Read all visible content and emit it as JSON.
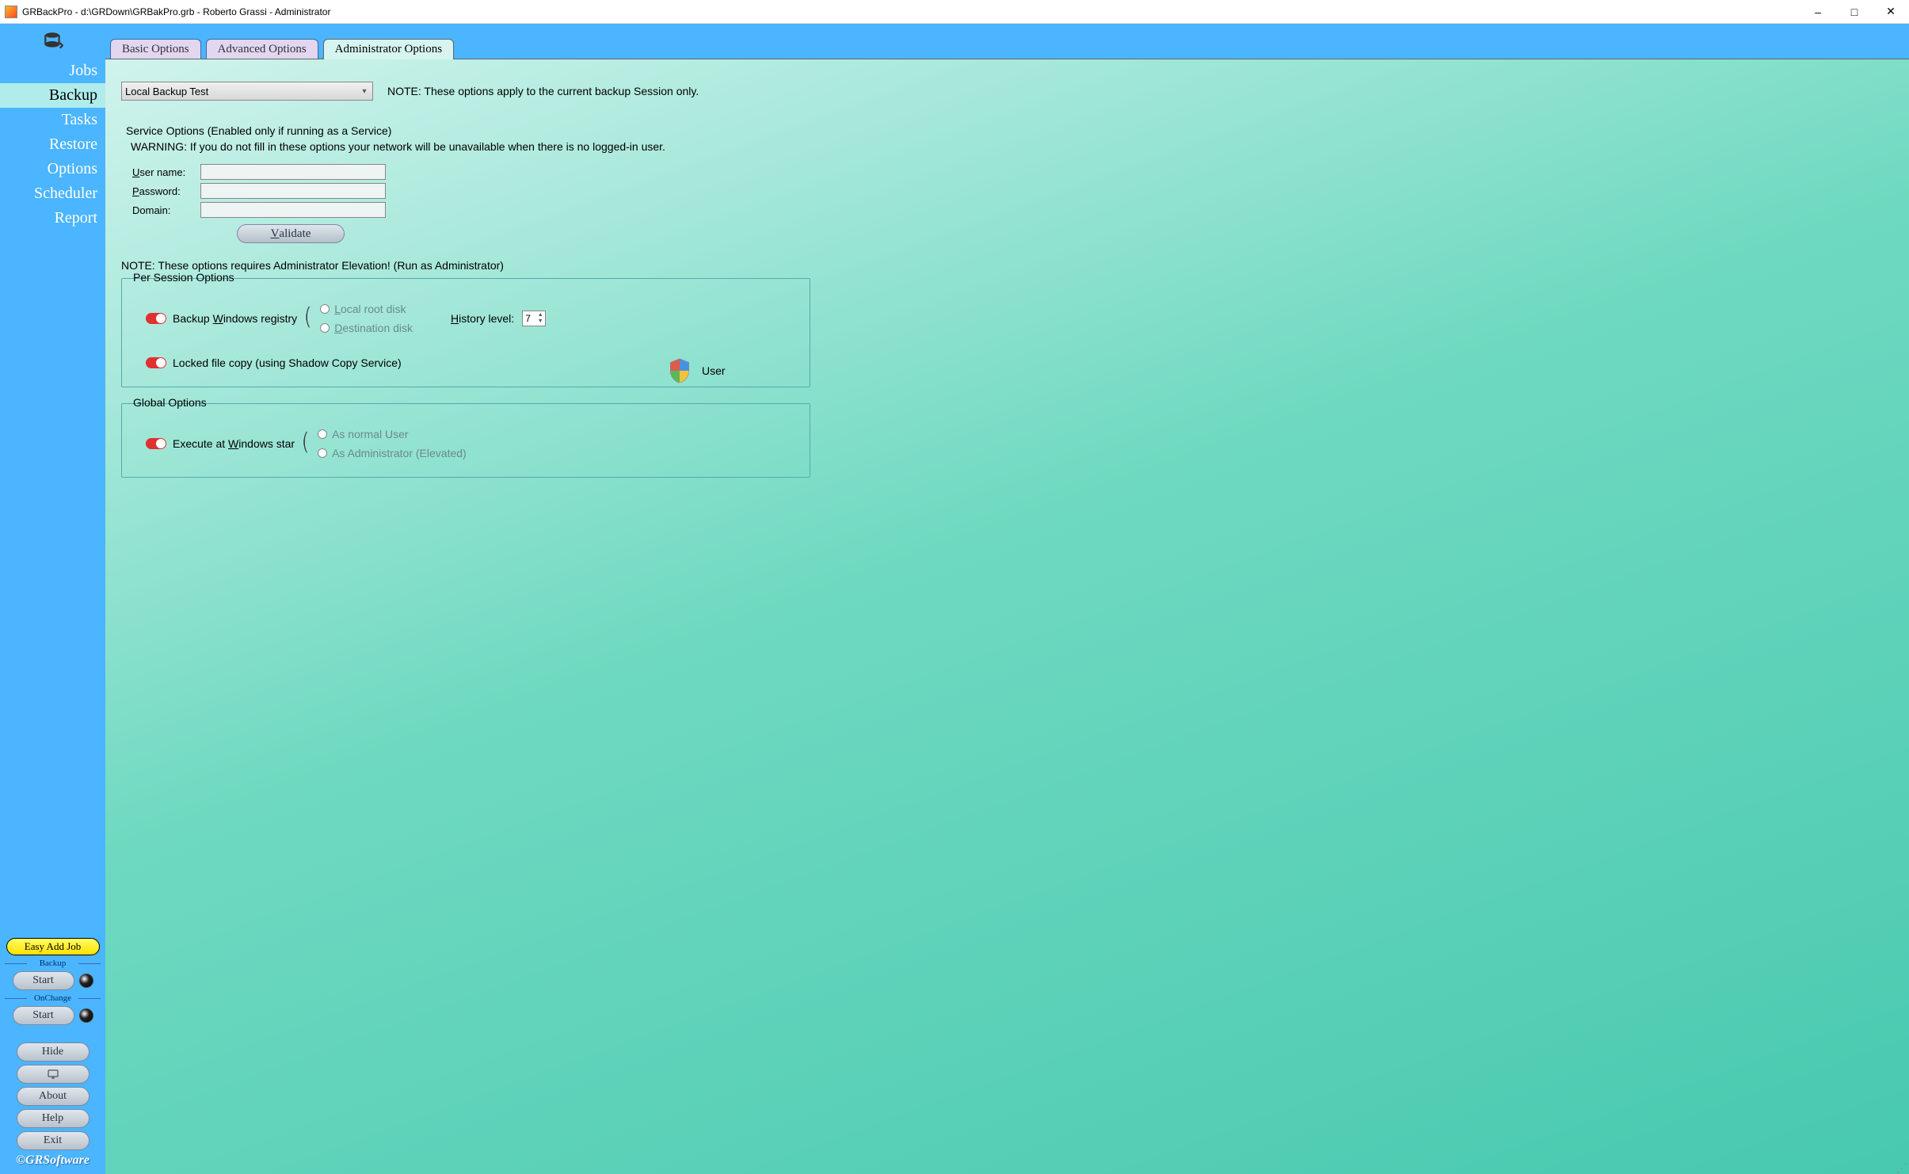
{
  "titlebar": {
    "title": "GRBackPro - d:\\GRDown\\GRBakPro.grb - Roberto Grassi - Administrator"
  },
  "sidebar": {
    "items": [
      "Jobs",
      "Backup",
      "Tasks",
      "Restore",
      "Options",
      "Scheduler",
      "Report"
    ],
    "active_index": 1,
    "easy_add_job": "Easy Add Job",
    "backup_label": "Backup",
    "onchange_label": "OnChange",
    "start": "Start",
    "hide": "Hide",
    "about": "About",
    "help": "Help",
    "exit": "Exit",
    "copyright": "©GRSoftware"
  },
  "tabs": {
    "items": [
      "Basic Options",
      "Advanced Options",
      "Administrator Options"
    ],
    "active_index": 2
  },
  "content": {
    "combo_value": "Local Backup Test",
    "note_apply": "NOTE: These options apply to the current backup Session only.",
    "service_title": "Service Options (Enabled only if running as a Service)",
    "warning": "WARNING: If you do not fill in these options your network will be unavailable when there is no logged-in user.",
    "username_label": "User name:",
    "password_label": "Password:",
    "domain_label": "Domain:",
    "validate": "Validate",
    "note_admin": "NOTE: These options requires Administrator Elevation! (Run as Administrator)",
    "per_session_title": "Per Session Options",
    "backup_registry": "Backup Windows registry",
    "local_root": "Local root disk",
    "dest_disk": "Destination disk",
    "history_level": "History level:",
    "history_value": "7",
    "locked_copy": "Locked file copy (using Shadow Copy Service)",
    "user_label": "User",
    "global_title": "Global Options",
    "exec_startup": "Execute at Windows star",
    "as_normal": "As normal User",
    "as_admin": "As Administrator (Elevated)"
  }
}
